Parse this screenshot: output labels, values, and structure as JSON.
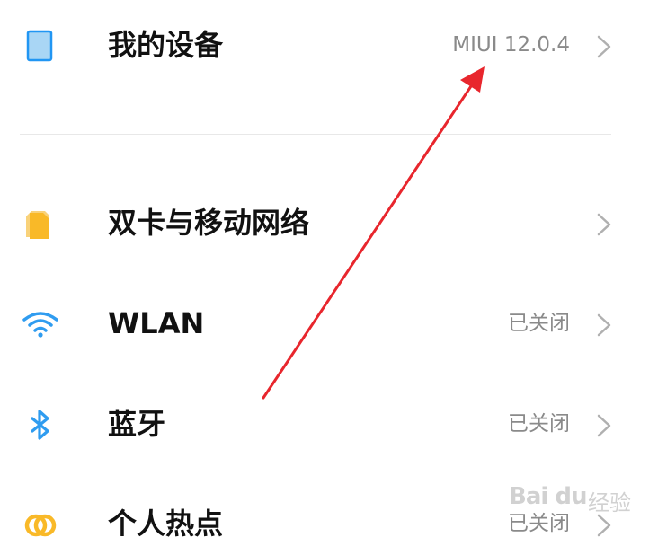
{
  "settings": {
    "items": [
      {
        "label": "我的设备",
        "value": "MIUI 12.0.4",
        "icon": "tablet-icon"
      },
      {
        "label": "双卡与移动网络",
        "value": "",
        "icon": "sim-card-icon"
      },
      {
        "label": "WLAN",
        "value": "已关闭",
        "icon": "wifi-icon"
      },
      {
        "label": "蓝牙",
        "value": "已关闭",
        "icon": "bluetooth-icon"
      },
      {
        "label": "个人热点",
        "value": "已关闭",
        "icon": "hotspot-icon"
      }
    ]
  },
  "watermark": {
    "logo": "Bai du",
    "text": "经验"
  },
  "colors": {
    "tablet": "#a9d6f5",
    "tablet_border": "#2196f3",
    "sim": "#f9b928",
    "wifi": "#2f9cf0",
    "bluetooth": "#2f9cf0",
    "hotspot": "#f9b928",
    "arrow": "#e8262d",
    "chevron": "#b0b0b0"
  }
}
